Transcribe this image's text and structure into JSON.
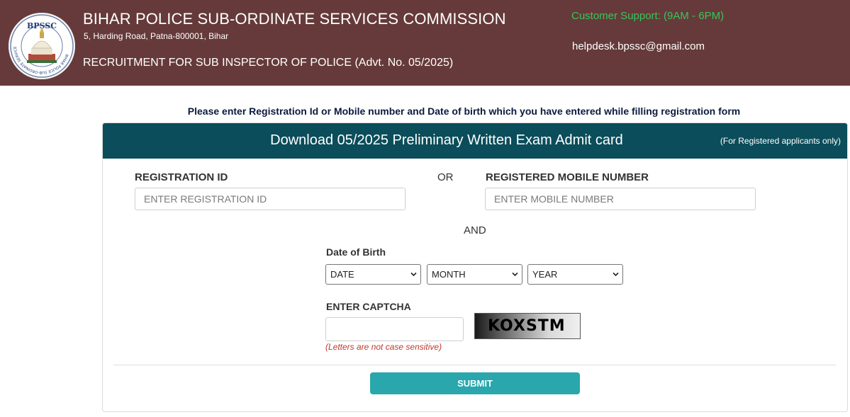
{
  "header": {
    "logo_text": "BPSSC",
    "logo_ring_text": "BIHAR POLICE SUB-ORDINATE SERVICES COMMISSION",
    "title": "BIHAR POLICE SUB-ORDINATE SERVICES COMMISSION",
    "address": "5, Harding Road, Patna-800001, Bihar",
    "recruitment": "RECRUITMENT FOR SUB INSPECTOR OF POLICE (Advt. No. 05/2025)",
    "support": "Customer Support: (9AM - 6PM)",
    "email": "helpdesk.bpssc@gmail.com"
  },
  "instruction": "Please enter Registration Id or Mobile number and Date of birth which you have entered while filling registration form",
  "card": {
    "title": "Download 05/2025 Preliminary Written Exam Admit card",
    "note": "(For Registered applicants only)"
  },
  "form": {
    "registration_label": "REGISTRATION ID",
    "registration_placeholder": "ENTER REGISTRATION ID",
    "or_text": "OR",
    "mobile_label": "REGISTERED MOBILE NUMBER",
    "mobile_placeholder": "ENTER MOBILE NUMBER",
    "and_text": "AND",
    "dob_label": "Date of Birth",
    "date_value": "DATE",
    "month_value": "MONTH",
    "year_value": "YEAR",
    "captcha_label": "ENTER CAPTCHA",
    "captcha_text": "KOXSTM",
    "captcha_hint": "(Letters are not case sensitive)",
    "submit_label": "SUBMIT"
  },
  "colors": {
    "header_bg": "#663a3a",
    "support_text": "#34c759",
    "card_header_bg": "#0b4d5a",
    "submit_bg": "#2aa6ad",
    "hint_text": "#c0392b"
  }
}
